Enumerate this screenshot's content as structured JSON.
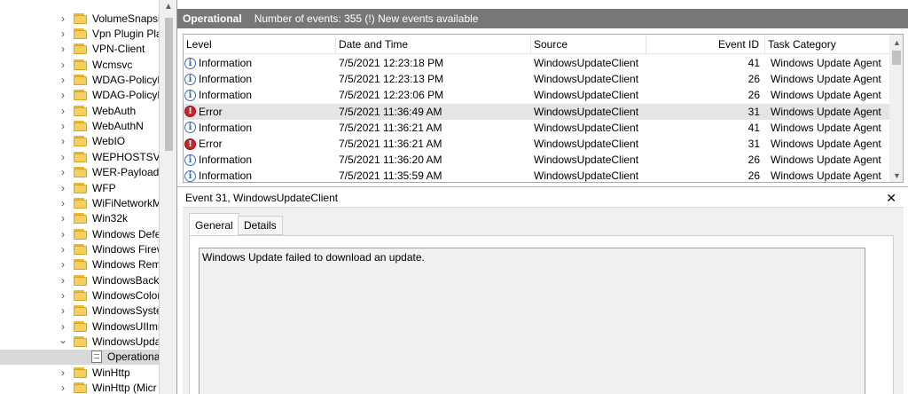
{
  "tree": {
    "items": [
      {
        "label": "VolumeSnapsh",
        "chevron": "right"
      },
      {
        "label": "Vpn Plugin Pla",
        "chevron": "right"
      },
      {
        "label": "VPN-Client",
        "chevron": "right"
      },
      {
        "label": "Wcmsvc",
        "chevron": "right"
      },
      {
        "label": "WDAG-PolicyE",
        "chevron": "right"
      },
      {
        "label": "WDAG-PolicyE",
        "chevron": "right"
      },
      {
        "label": "WebAuth",
        "chevron": "right"
      },
      {
        "label": "WebAuthN",
        "chevron": "right"
      },
      {
        "label": "WebIO",
        "chevron": "right"
      },
      {
        "label": "WEPHOSTSVC",
        "chevron": "right"
      },
      {
        "label": "WER-PayloadH",
        "chevron": "right"
      },
      {
        "label": "WFP",
        "chevron": "right"
      },
      {
        "label": "WiFiNetworkM",
        "chevron": "right"
      },
      {
        "label": "Win32k",
        "chevron": "right"
      },
      {
        "label": "Windows Defe",
        "chevron": "right"
      },
      {
        "label": "Windows Firev",
        "chevron": "right"
      },
      {
        "label": "Windows Rem",
        "chevron": "right"
      },
      {
        "label": "WindowsBacku",
        "chevron": "right"
      },
      {
        "label": "WindowsColor",
        "chevron": "right"
      },
      {
        "label": "WindowsSyste",
        "chevron": "right"
      },
      {
        "label": "WindowsUIImr",
        "chevron": "right"
      },
      {
        "label": "WindowsUpda",
        "chevron": "down"
      },
      {
        "label": "Operational",
        "chevron": "none",
        "child": true,
        "selected": true
      },
      {
        "label": "WinHttp",
        "chevron": "right"
      },
      {
        "label": "WinHttp (Micr",
        "chevron": "right"
      }
    ]
  },
  "header": {
    "title": "Operational",
    "info": "Number of events: 355 (!) New events available"
  },
  "grid": {
    "columns": [
      "Level",
      "Date and Time",
      "Source",
      "Event ID",
      "Task Category"
    ],
    "rows": [
      {
        "level": "Information",
        "type": "info",
        "datetime": "7/5/2021 12:23:18 PM",
        "source": "WindowsUpdateClient",
        "id": "41",
        "category": "Windows Update Agent"
      },
      {
        "level": "Information",
        "type": "info",
        "datetime": "7/5/2021 12:23:13 PM",
        "source": "WindowsUpdateClient",
        "id": "26",
        "category": "Windows Update Agent"
      },
      {
        "level": "Information",
        "type": "info",
        "datetime": "7/5/2021 12:23:06 PM",
        "source": "WindowsUpdateClient",
        "id": "26",
        "category": "Windows Update Agent"
      },
      {
        "level": "Error",
        "type": "error",
        "datetime": "7/5/2021 11:36:49 AM",
        "source": "WindowsUpdateClient",
        "id": "31",
        "category": "Windows Update Agent",
        "selected": true
      },
      {
        "level": "Information",
        "type": "info",
        "datetime": "7/5/2021 11:36:21 AM",
        "source": "WindowsUpdateClient",
        "id": "41",
        "category": "Windows Update Agent"
      },
      {
        "level": "Error",
        "type": "error",
        "datetime": "7/5/2021 11:36:21 AM",
        "source": "WindowsUpdateClient",
        "id": "31",
        "category": "Windows Update Agent"
      },
      {
        "level": "Information",
        "type": "info",
        "datetime": "7/5/2021 11:36:20 AM",
        "source": "WindowsUpdateClient",
        "id": "26",
        "category": "Windows Update Agent"
      },
      {
        "level": "Information",
        "type": "info",
        "datetime": "7/5/2021 11:35:59 AM",
        "source": "WindowsUpdateClient",
        "id": "26",
        "category": "Windows Update Agent"
      }
    ]
  },
  "details": {
    "title": "Event 31, WindowsUpdateClient",
    "tabs": [
      "General",
      "Details"
    ],
    "description": "Windows Update failed to download an update."
  },
  "icons": {
    "info": "i",
    "error": "!",
    "close": "✕",
    "chevron_right": "›",
    "chevron_down": "⌄",
    "scroll_up": "▲",
    "scroll_down": "▼"
  },
  "colors": {
    "header_bar": "#777777",
    "selected_row": "#e5e5e5",
    "error_red": "#c4262e",
    "info_blue": "#3c6ab0",
    "folder_yellow": "#f7cf5f"
  }
}
